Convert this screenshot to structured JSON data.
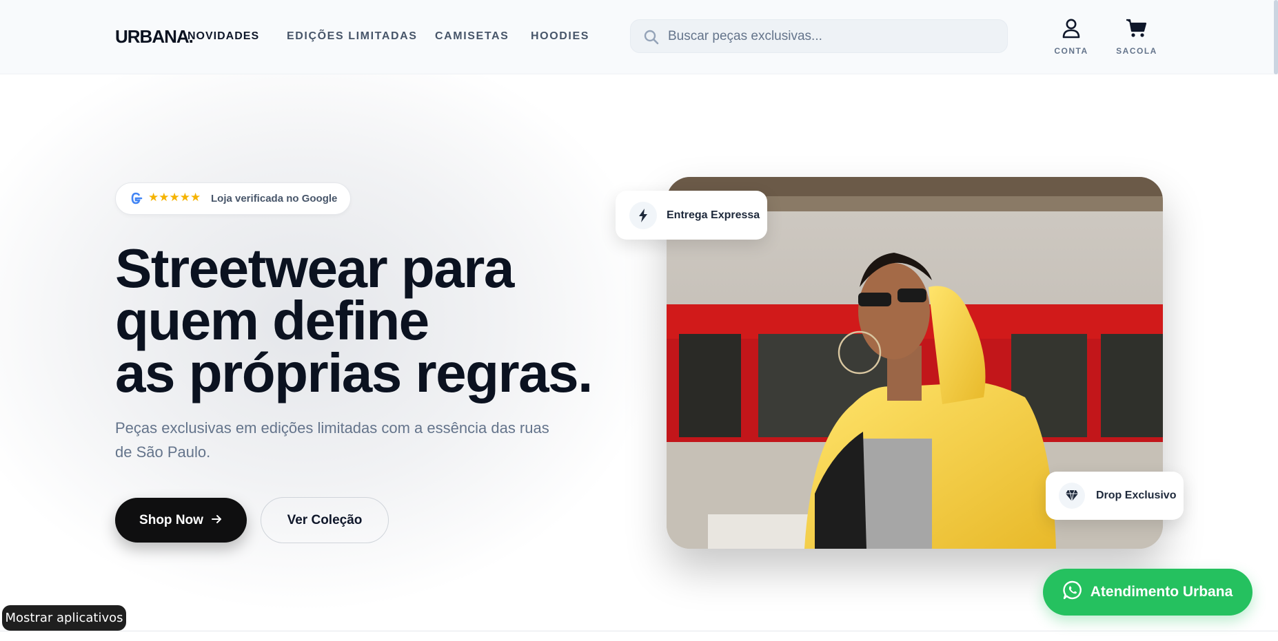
{
  "header": {
    "logo": "URBANA.",
    "nav": [
      "NOVIDADES",
      "EDIÇÕES LIMITADAS",
      "CAMISETAS",
      "HOODIES"
    ],
    "search_placeholder": "Buscar peças exclusivas...",
    "account_label": "CONTA",
    "bag_label": "SACOLA"
  },
  "hero": {
    "badge": {
      "stars": "★★★★★",
      "text": "Loja verificada no Google"
    },
    "headline": [
      "Streetwear para",
      "quem define",
      "as próprias regras."
    ],
    "subtitle": "Peças exclusivas em edições limitadas com a essência das ruas de São Paulo.",
    "primary_button": "Shop Now",
    "secondary_button": "Ver Coleção",
    "card_delivery": "Entrega Expressa",
    "card_drop": "Drop Exclusivo"
  },
  "whatsapp_label": "Atendimento Urbana",
  "apps_label": "Mostrar aplicativos",
  "icons": {
    "search": "search-icon",
    "account": "user-icon",
    "bag": "cart-icon",
    "google": "google-icon",
    "bolt": "lightning-icon",
    "diamond": "gem-icon",
    "arrow": "arrow-right-icon",
    "whatsapp": "whatsapp-icon"
  },
  "colors": {
    "primary_dark": "#0f0f10",
    "whatsapp": "#25c15f",
    "star": "#f5b301",
    "muted_text": "#64748b"
  }
}
